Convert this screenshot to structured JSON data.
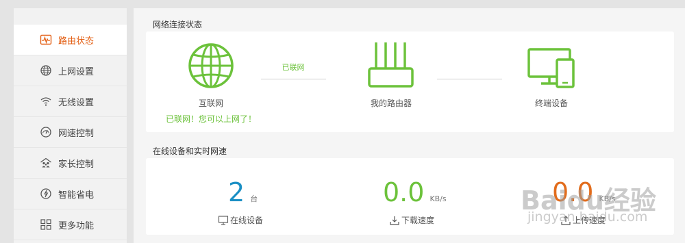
{
  "sidebar": {
    "items": [
      {
        "label": "路由状态",
        "icon": "pulse-icon",
        "active": true
      },
      {
        "label": "上网设置",
        "icon": "globe-icon",
        "active": false
      },
      {
        "label": "无线设置",
        "icon": "wifi-icon",
        "active": false
      },
      {
        "label": "网速控制",
        "icon": "speedometer-icon",
        "active": false
      },
      {
        "label": "家长控制",
        "icon": "family-icon",
        "active": false
      },
      {
        "label": "智能省电",
        "icon": "power-save-icon",
        "active": false
      },
      {
        "label": "更多功能",
        "icon": "grid-icon",
        "active": false
      }
    ]
  },
  "connection": {
    "section_title": "网络连接状态",
    "internet_label": "互联网",
    "link_status": "已联网",
    "router_label": "我的路由器",
    "devices_label": "终端设备",
    "online_message": "已联网！您可以上网了！"
  },
  "realtime": {
    "section_title": "在线设备和实时网速",
    "devices_count": "2",
    "devices_unit": "台",
    "devices_label": "在线设备",
    "download_value": "0.0",
    "download_unit": "KB/s",
    "download_label": "下载速度",
    "upload_value": "0.0",
    "upload_unit": "KB/s",
    "upload_label": "上传速度"
  },
  "colors": {
    "accent": "#e35f14",
    "green": "#6cc23b",
    "blue": "#1a8fc4",
    "orange": "#e26c1c"
  },
  "watermark": {
    "brand": "Baidu经验",
    "url": "jingyan.baidu.com"
  }
}
